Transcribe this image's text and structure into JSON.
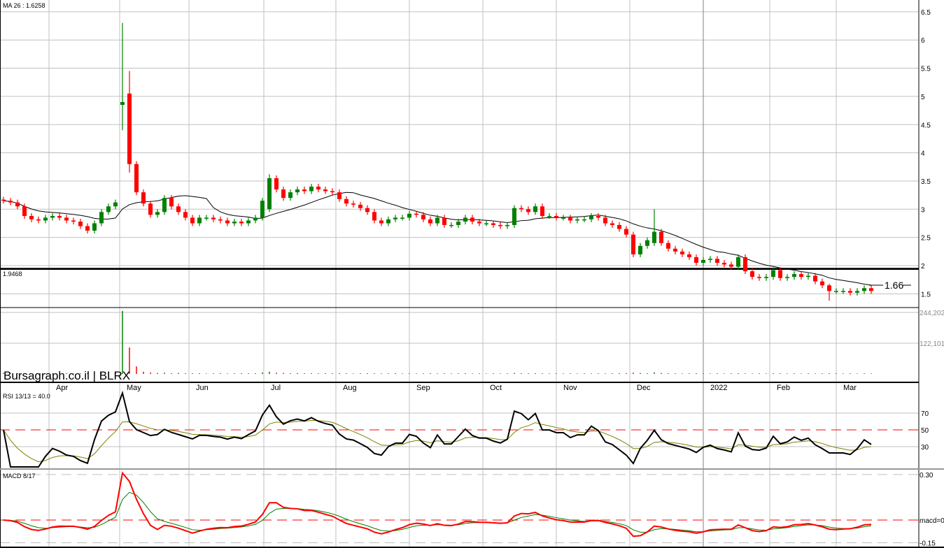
{
  "header": {
    "ma_label": "MA 26 : 1.6258",
    "line_label": "1.9468",
    "last_price_label": "1.66",
    "brand": "Bursagraph.co.il | BLRX"
  },
  "colors": {
    "up": "#008000",
    "down": "#ff0000",
    "grid": "#c0c0c0",
    "rsi_signal": "#808000",
    "macd": "#ff0000",
    "macd_signal": "#008000"
  },
  "chart_data": {
    "type": "candlestick",
    "title": "BLRX",
    "price_axis": {
      "ticks": [
        6.5,
        6,
        5.5,
        5,
        4.5,
        4,
        3.5,
        3,
        2.5,
        2,
        1.5
      ],
      "tick_labels": [
        "6.5",
        "6",
        "5.5",
        "5",
        "4.5",
        "4",
        "3.5",
        "3",
        "2.5",
        "2",
        "1.5"
      ]
    },
    "volume_axis": {
      "ticks": [
        244202,
        122101
      ],
      "tick_labels": [
        "244,202",
        "122,101"
      ]
    },
    "months": [
      "Apr",
      "May",
      "Jun",
      "Jul",
      "Aug",
      "Sep",
      "Oct",
      "Nov",
      "Dec",
      "2022",
      "Feb",
      "Mar"
    ],
    "horizontal_line": 1.9468,
    "last_price": 1.66,
    "ma_period": 26,
    "close": [
      3.15,
      3.12,
      3.05,
      2.88,
      2.82,
      2.8,
      2.85,
      2.88,
      2.85,
      2.8,
      2.78,
      2.7,
      2.62,
      2.75,
      2.95,
      3.05,
      3.12,
      4.9,
      3.8,
      3.3,
      3.1,
      2.9,
      2.95,
      3.2,
      3.05,
      2.95,
      2.85,
      2.75,
      2.85,
      2.85,
      2.82,
      2.8,
      2.75,
      2.78,
      2.75,
      2.8,
      2.85,
      3.15,
      3.55,
      3.35,
      3.2,
      3.3,
      3.35,
      3.32,
      3.4,
      3.35,
      3.32,
      3.3,
      3.18,
      3.1,
      3.08,
      3.02,
      2.95,
      2.8,
      2.75,
      2.82,
      2.85,
      2.85,
      2.92,
      2.9,
      2.82,
      2.75,
      2.85,
      2.72,
      2.72,
      2.78,
      2.85,
      2.78,
      2.75,
      2.75,
      2.72,
      2.7,
      2.72,
      3.02,
      3.0,
      2.95,
      3.05,
      2.88,
      2.88,
      2.85,
      2.85,
      2.8,
      2.82,
      2.82,
      2.88,
      2.85,
      2.75,
      2.72,
      2.65,
      2.55,
      2.2,
      2.35,
      2.45,
      2.6,
      2.4,
      2.3,
      2.25,
      2.2,
      2.15,
      2.05,
      2.1,
      2.12,
      2.05,
      2.02,
      1.98,
      2.15,
      1.9,
      1.8,
      1.78,
      1.8,
      1.92,
      1.78,
      1.8,
      1.85,
      1.8,
      1.82,
      1.72,
      1.65,
      1.55,
      1.55,
      1.55,
      1.52,
      1.55,
      1.6,
      1.55
    ],
    "candle_overrides": [
      {
        "index": 17,
        "open": 4.85,
        "high": 6.3,
        "low": 4.4,
        "close": 4.9
      },
      {
        "index": 18,
        "open": 5.05,
        "high": 5.45,
        "low": 3.65,
        "close": 3.8
      },
      {
        "index": 38,
        "open": 3.0,
        "high": 3.62,
        "low": 2.95,
        "close": 3.55
      },
      {
        "index": 93,
        "open": 2.4,
        "high": 3.0,
        "low": 2.35,
        "close": 2.6
      },
      {
        "index": 118,
        "open": 1.65,
        "high": 1.68,
        "low": 1.38,
        "close": 1.55
      }
    ],
    "wick": 0.05,
    "volume": [
      4000,
      3000,
      2500,
      3000,
      2000,
      2500,
      3000,
      2000,
      2500,
      3000,
      2000,
      2500,
      3000,
      2500,
      4000,
      5000,
      8000,
      250000,
      105000,
      30000,
      9000,
      6000,
      4000,
      5000,
      3000,
      4000,
      3000,
      2500,
      3000,
      2000,
      2500,
      3000,
      2000,
      2500,
      3000,
      2500,
      3000,
      6000,
      9000,
      5000,
      4000,
      3000,
      3500,
      3000,
      3000,
      2500,
      3000,
      2500,
      3000,
      2500,
      2000,
      2500,
      3000,
      2500,
      2000,
      2500,
      3000,
      2000,
      2500,
      2000,
      2500,
      3000,
      2000,
      2500,
      2000,
      2500,
      3000,
      2000,
      2500,
      2000,
      2500,
      2000,
      2500,
      4000,
      3000,
      2500,
      3000,
      2500,
      2000,
      2500,
      2000,
      2500,
      2000,
      2500,
      2000,
      2500,
      2000,
      2500,
      3000,
      3500,
      5000,
      4000,
      3000,
      6000,
      4000,
      3000,
      2500,
      2000,
      2500,
      3000,
      2500,
      2000,
      2500,
      2000,
      2500,
      3000,
      2500,
      2000,
      2500,
      2000,
      3000,
      2500,
      2000,
      2500,
      2000,
      2500,
      2000,
      2500,
      3000,
      2500,
      2000,
      2500,
      2000,
      2500,
      2000
    ],
    "rsi": {
      "label": "RSI 13/13 = 40.0",
      "levels": [
        70,
        50,
        30
      ],
      "level_labels": [
        "70",
        "50",
        "30"
      ],
      "value": 40.0
    },
    "macd": {
      "label": "MACD 8/17",
      "tick_labels": [
        "0.30",
        "macd=0",
        "-0.15"
      ],
      "ticks": [
        0.3,
        0,
        -0.15
      ]
    }
  }
}
